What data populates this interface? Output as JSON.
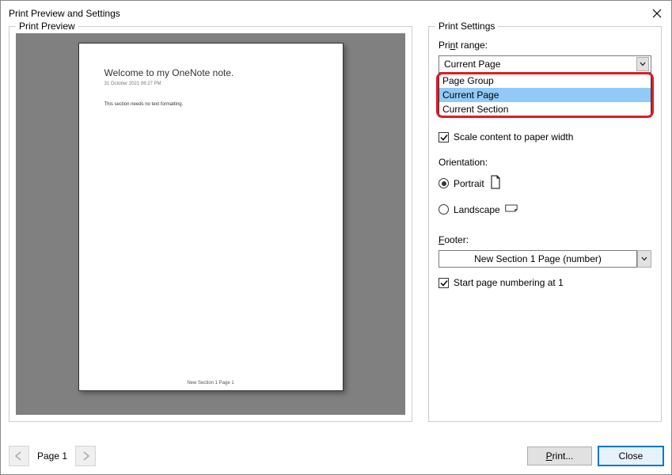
{
  "window": {
    "title": "Print Preview and Settings"
  },
  "left": {
    "legend": "Print Preview",
    "page": {
      "title": "Welcome to my OneNote note.",
      "meta": "31 October 2021     06:27 PM",
      "body": "This section needs no text formatting.",
      "footer": "New Section 1 Page 1"
    }
  },
  "right": {
    "legend": "Print Settings",
    "print_range_label_pre": "Pri",
    "print_range_label_u": "n",
    "print_range_label_post": "t range:",
    "print_range_value": "Current Page",
    "print_range_options": [
      "Page Group",
      "Current Page",
      "Current Section"
    ],
    "scale_label": "Scale content to paper width",
    "orientation_label": "Orientation:",
    "portrait": "Portrait",
    "landscape": "Landscape",
    "footer_label_u": "F",
    "footer_label_post": "ooter:",
    "footer_value": "New Section 1 Page (number)",
    "start_numbering": "Start page numbering at 1"
  },
  "bottom": {
    "page_indicator": "Page 1",
    "print_btn_u": "P",
    "print_btn_post": "rint...",
    "close_btn": "Close"
  }
}
